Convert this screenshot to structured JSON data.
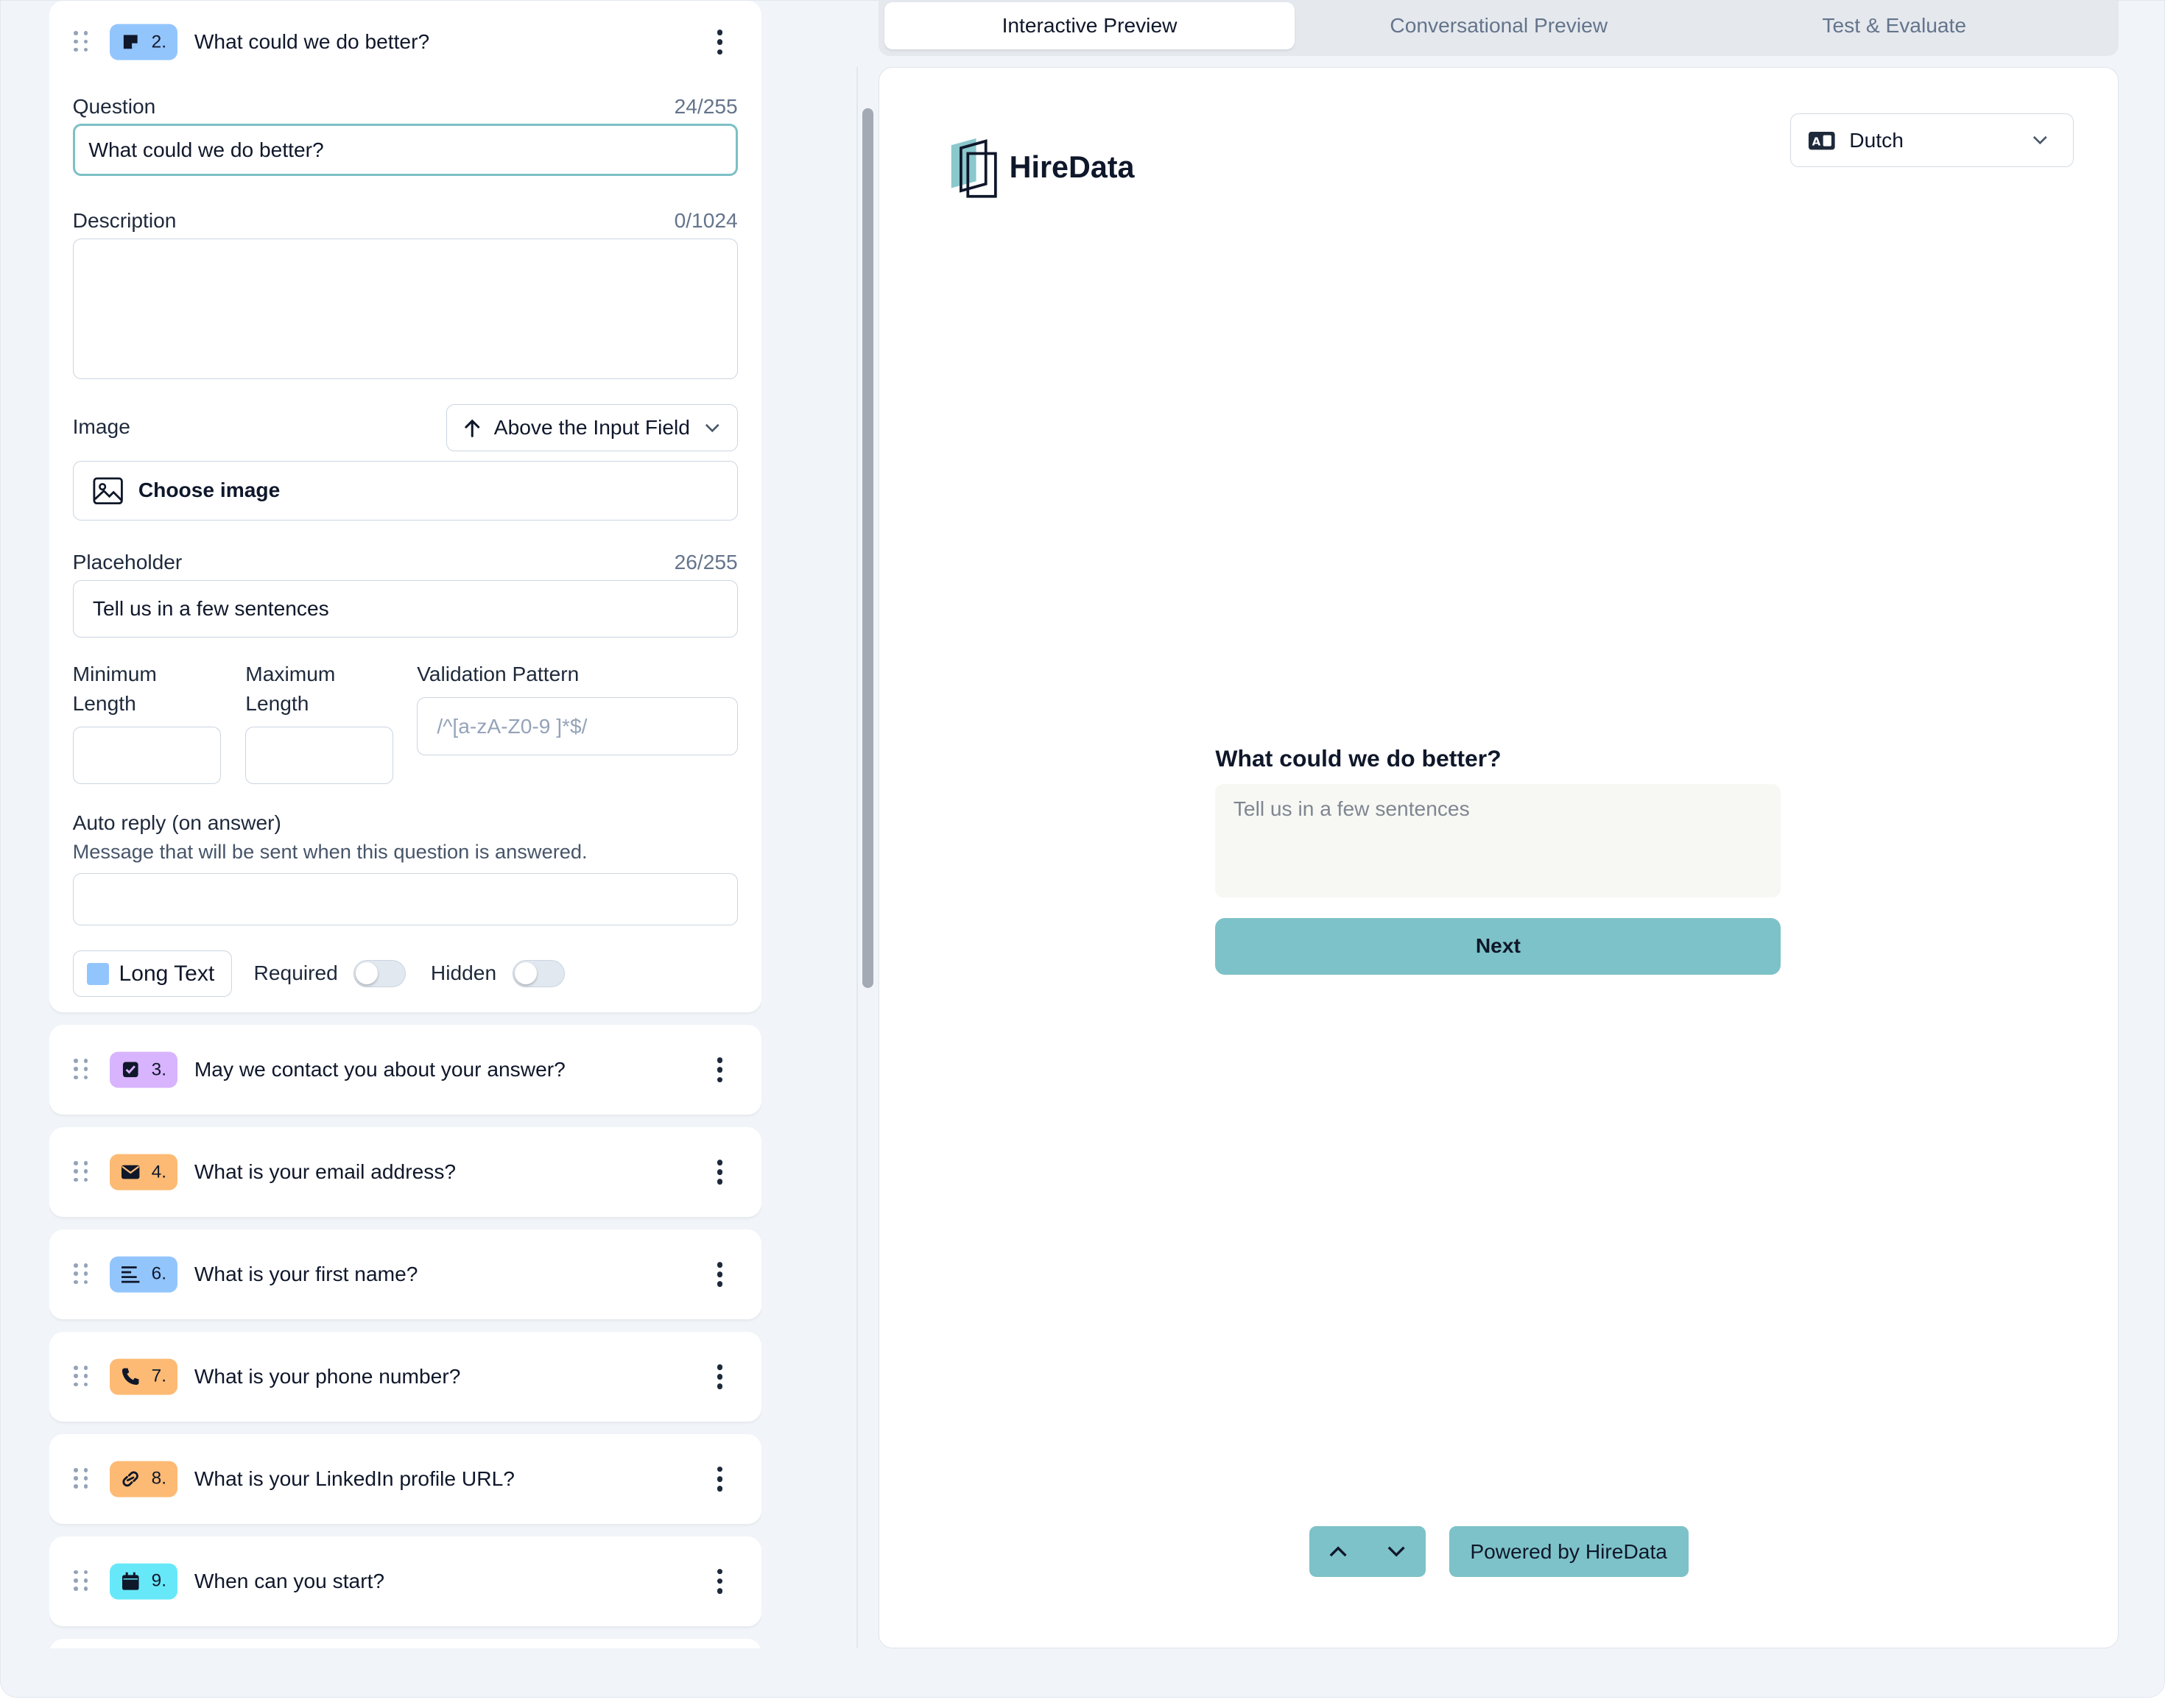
{
  "active_question": {
    "number": "2.",
    "title": "What could we do better?",
    "question_label": "Question",
    "question_count": "24/255",
    "question_value": "What could we do better?",
    "description_label": "Description",
    "description_count": "0/1024",
    "description_value": "",
    "image_label": "Image",
    "image_position": "Above the Input Field",
    "choose_image": "Choose image",
    "placeholder_label": "Placeholder",
    "placeholder_count": "26/255",
    "placeholder_value": "Tell us in a few sentences",
    "min_length_label": "Minimum Length",
    "max_length_label": "Maximum Length",
    "validation_label": "Validation Pattern",
    "validation_placeholder": "/^[a-zA-Z0-9 ]*$/",
    "auto_reply_label": "Auto reply (on answer)",
    "auto_reply_help": "Message that will be sent when this question is answered.",
    "type_label": "Long Text",
    "required_label": "Required",
    "required_on": false,
    "hidden_label": "Hidden",
    "hidden_on": false
  },
  "questions": [
    {
      "number": "3.",
      "title": "May we contact you about your answer?",
      "icon": "checkbox-icon",
      "color": "#d8b4fe"
    },
    {
      "number": "4.",
      "title": "What is your email address?",
      "icon": "envelope-icon",
      "color": "#fdba74"
    },
    {
      "number": "6.",
      "title": "What is your first name?",
      "icon": "short-text-icon",
      "color": "#93c5fd"
    },
    {
      "number": "7.",
      "title": "What is your phone number?",
      "icon": "phone-icon",
      "color": "#fdba74"
    },
    {
      "number": "8.",
      "title": "What is your LinkedIn profile URL?",
      "icon": "link-icon",
      "color": "#fdba74"
    },
    {
      "number": "9.",
      "title": "When can you start?",
      "icon": "calendar-icon",
      "color": "#67e8f9"
    }
  ],
  "tabs": [
    "Interactive Preview",
    "Conversational Preview",
    "Test & Evaluate"
  ],
  "active_tab": 0,
  "preview": {
    "language": "Dutch",
    "brand": "HireData",
    "question": "What could we do better?",
    "answer_placeholder": "Tell us in a few sentences",
    "next_label": "Next",
    "powered_by": "Powered by HireData"
  },
  "colors": {
    "accent": "#7dc2c8",
    "focus_border": "#7cc0c5"
  }
}
